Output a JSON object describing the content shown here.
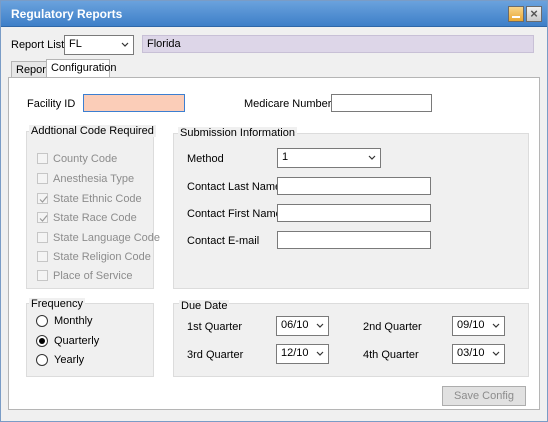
{
  "window": {
    "title": "Regulatory Reports"
  },
  "report_list": {
    "label": "Report List",
    "selected": "FL",
    "name_display": "Florida"
  },
  "tabs": [
    {
      "label": "Report"
    },
    {
      "label": "Configuration"
    }
  ],
  "facility": {
    "label": "Facility ID",
    "value": ""
  },
  "medicare": {
    "label": "Medicare Number",
    "value": ""
  },
  "additional_codes": {
    "title": "Addtional Code Required",
    "items": [
      {
        "label": "County Code",
        "checked": false
      },
      {
        "label": "Anesthesia Type",
        "checked": false
      },
      {
        "label": "State Ethnic Code",
        "checked": true
      },
      {
        "label": "State Race Code",
        "checked": true
      },
      {
        "label": "State Language Code",
        "checked": false
      },
      {
        "label": "State Religion Code",
        "checked": false
      },
      {
        "label": "Place of Service",
        "checked": false
      }
    ]
  },
  "submission": {
    "title": "Submission Information",
    "method_label": "Method",
    "method_value": "1",
    "last_name_label": "Contact Last Name",
    "first_name_label": "Contact First Name",
    "email_label": "Contact E-mail"
  },
  "frequency": {
    "title": "Frequency",
    "options": [
      {
        "label": "Monthly",
        "selected": false
      },
      {
        "label": "Quarterly",
        "selected": true
      },
      {
        "label": "Yearly",
        "selected": false
      }
    ]
  },
  "due_date": {
    "title": "Due Date",
    "q1_label": "1st Quarter",
    "q1_value": "06/10",
    "q2_label": "2nd Quarter",
    "q2_value": "09/10",
    "q3_label": "3rd Quarter",
    "q3_value": "12/10",
    "q4_label": "4th Quarter",
    "q4_value": "03/10"
  },
  "save_button": {
    "label": "Save Config"
  },
  "colors": {
    "titlebar": "#3e7fc8",
    "focus_field": "#fbcdb8",
    "readonly_field": "#ddd6e8"
  }
}
